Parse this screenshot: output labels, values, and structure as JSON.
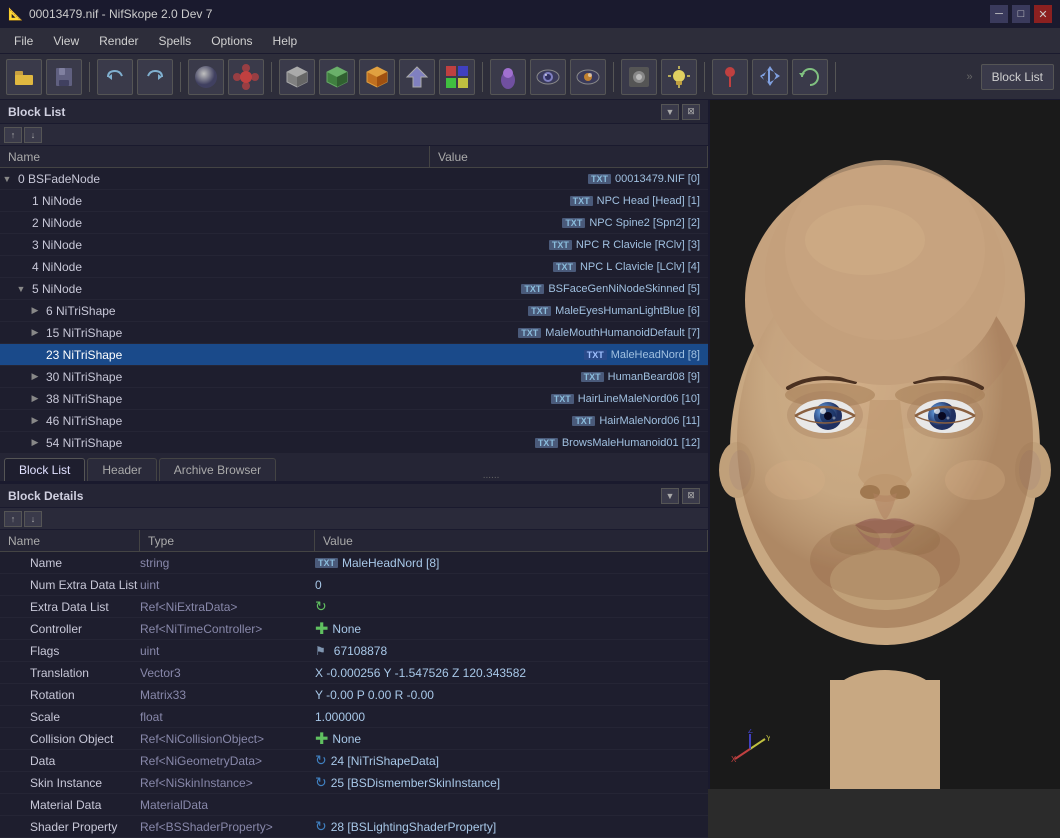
{
  "titlebar": {
    "title": "00013479.nif - NifSkope 2.0 Dev 7",
    "icon": "🎮",
    "controls": [
      "minimize",
      "maximize",
      "close"
    ]
  },
  "menubar": {
    "items": [
      "File",
      "View",
      "Render",
      "Spells",
      "Options",
      "Help"
    ]
  },
  "toolbar": {
    "block_list_label": "Block List"
  },
  "block_list": {
    "header": "Block List",
    "columns": [
      "Name",
      "Value"
    ],
    "rows": [
      {
        "indent": 0,
        "expand": "▼",
        "name": "0 BSFadeNode",
        "badge": "TXT",
        "value": "00013479.NIF [0]"
      },
      {
        "indent": 1,
        "expand": "",
        "name": "1 NiNode",
        "badge": "TXT",
        "value": "NPC Head [Head] [1]"
      },
      {
        "indent": 1,
        "expand": "",
        "name": "2 NiNode",
        "badge": "TXT",
        "value": "NPC Spine2 [Spn2] [2]"
      },
      {
        "indent": 1,
        "expand": "",
        "name": "3 NiNode",
        "badge": "TXT",
        "value": "NPC R Clavicle [RClv] [3]"
      },
      {
        "indent": 1,
        "expand": "",
        "name": "4 NiNode",
        "badge": "TXT",
        "value": "NPC L Clavicle [LClv] [4]"
      },
      {
        "indent": 1,
        "expand": "▼",
        "name": "5 NiNode",
        "badge": "TXT",
        "value": "BSFaceGenNiNodeSkinned [5]"
      },
      {
        "indent": 2,
        "expand": "▶",
        "name": "6 NiTriShape",
        "badge": "TXT",
        "value": "MaleEyesHumanLightBlue [6]"
      },
      {
        "indent": 2,
        "expand": "▶",
        "name": "15 NiTriShape",
        "badge": "TXT",
        "value": "MaleMouthHumanoidDefault [7]"
      },
      {
        "indent": 2,
        "expand": "",
        "name": "23 NiTriShape",
        "badge": "TXT",
        "value": "MaleHeadNord [8]",
        "selected": true
      },
      {
        "indent": 2,
        "expand": "▶",
        "name": "30 NiTriShape",
        "badge": "TXT",
        "value": "HumanBeard08 [9]"
      },
      {
        "indent": 2,
        "expand": "▶",
        "name": "38 NiTriShape",
        "badge": "TXT",
        "value": "HairLineMaleNord06 [10]"
      },
      {
        "indent": 2,
        "expand": "▶",
        "name": "46 NiTriShape",
        "badge": "TXT",
        "value": "HairMaleNord06 [11]"
      },
      {
        "indent": 2,
        "expand": "▶",
        "name": "54 NiTriShape",
        "badge": "TXT",
        "value": "BrowsMaleHumanoid01 [12]"
      }
    ]
  },
  "tabs": {
    "items": [
      "Block List",
      "Header",
      "Archive Browser"
    ],
    "active": "Block List",
    "dots": "......"
  },
  "block_details": {
    "header": "Block Details",
    "columns": [
      "Name",
      "Type",
      "Value"
    ],
    "rows": [
      {
        "name": "Name",
        "indent": 1,
        "type": "string",
        "icon": "txt",
        "value": "MaleHeadNord [8]"
      },
      {
        "name": "Num Extra Data List",
        "indent": 1,
        "type": "uint",
        "icon": "",
        "value": "0"
      },
      {
        "name": "Extra Data List",
        "indent": 1,
        "type": "Ref<NiExtraData>",
        "icon": "cycle",
        "value": ""
      },
      {
        "name": "Controller",
        "indent": 1,
        "type": "Ref<NiTimeController>",
        "icon": "plus_green",
        "value": "None"
      },
      {
        "name": "Flags",
        "indent": 1,
        "type": "uint",
        "icon": "",
        "value": "67108878"
      },
      {
        "name": "Translation",
        "indent": 1,
        "type": "Vector3",
        "icon": "",
        "value": "X -0.000256 Y -1.547526 Z 120.343582"
      },
      {
        "name": "Rotation",
        "indent": 1,
        "type": "Matrix33",
        "icon": "",
        "value": "Y -0.00 P 0.00 R -0.00"
      },
      {
        "name": "Scale",
        "indent": 1,
        "type": "float",
        "icon": "",
        "value": "1.000000"
      },
      {
        "name": "Collision Object",
        "indent": 1,
        "type": "Ref<NiCollisionObject>",
        "icon": "plus_green",
        "value": "None"
      },
      {
        "name": "Data",
        "indent": 1,
        "type": "Ref<NiGeometryData>",
        "icon": "cycle_blue",
        "value": "24 [NiTriShapeData]"
      },
      {
        "name": "Skin Instance",
        "indent": 1,
        "type": "Ref<NiSkinInstance>",
        "icon": "cycle_blue",
        "value": "25 [BSDismemberSkinInstance]"
      },
      {
        "name": "Material Data",
        "indent": 1,
        "type": "MaterialData",
        "icon": "",
        "value": ""
      },
      {
        "name": "Shader Property",
        "indent": 1,
        "type": "Ref<BSShaderProperty>",
        "icon": "cycle_blue",
        "value": "28 [BSLightingShaderProperty]"
      }
    ]
  }
}
